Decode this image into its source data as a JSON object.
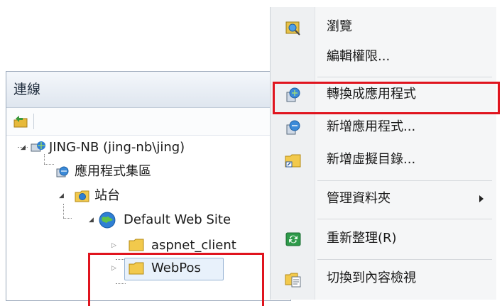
{
  "connections": {
    "title": "連線",
    "tree": {
      "server": "JING-NB (jing-nb\\jing)",
      "app_pools": "應用程式集區",
      "sites": "站台",
      "default_site": "Default Web Site",
      "folder1": "aspnet_client",
      "folder2": "WebPos"
    }
  },
  "context_menu": {
    "items": [
      {
        "label": "瀏覽",
        "icon": "browse-icon"
      },
      {
        "label": "編輯權限...",
        "icon": ""
      },
      {
        "label": "轉換成應用程式",
        "icon": "convert-application-icon"
      },
      {
        "label": "新增應用程式...",
        "icon": "add-application-icon"
      },
      {
        "label": "新增虛擬目錄...",
        "icon": "add-virtual-directory-icon"
      },
      {
        "label": "管理資料夾",
        "icon": "",
        "submenu": true
      },
      {
        "label": "重新整理(R)",
        "icon": "refresh-icon"
      },
      {
        "label": "切換到內容檢視",
        "icon": "content-view-icon"
      }
    ]
  },
  "colors": {
    "highlight_box": "#e0141e",
    "panel_border": "#9aa8ba",
    "globe": "#2f7fd4",
    "folder": "#f2c94c"
  }
}
